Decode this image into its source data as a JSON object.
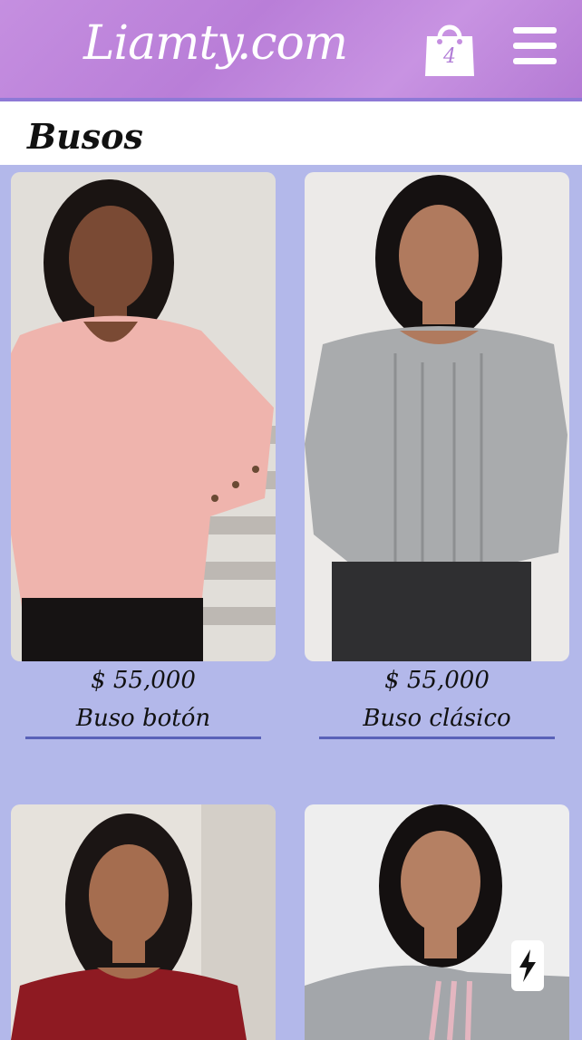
{
  "header": {
    "logo": "Liamty.com",
    "cart_count": "4",
    "cart_icon": "shopping-bag-icon",
    "menu_icon": "hamburger-menu-icon"
  },
  "section": {
    "title": "Busos"
  },
  "products": [
    {
      "price": "$ 55,000",
      "name": "Buso botón"
    },
    {
      "price": "$ 55,000",
      "name": "Buso clásico"
    },
    {
      "price": "",
      "name": ""
    },
    {
      "price": "",
      "name": ""
    }
  ],
  "colors": {
    "header": "#c58fe0",
    "background": "#b3b8ea",
    "underline": "#5961b8"
  },
  "floating_action_icon": "lightning-bolt-icon"
}
